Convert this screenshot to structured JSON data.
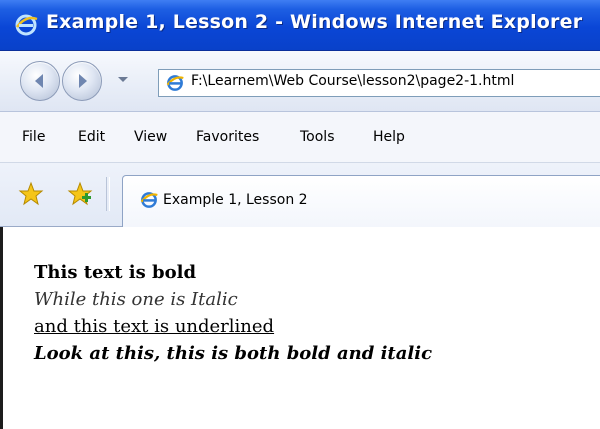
{
  "window": {
    "title": "Example 1, Lesson 2 - Windows Internet Explorer",
    "title_bar_color": "#0a46d6"
  },
  "address_bar": {
    "url": "F:\\Learnem\\Web Course\\lesson2\\page2-1.html",
    "icons": [
      "back-arrow-icon",
      "forward-arrow-icon",
      "ie-logo-icon"
    ]
  },
  "menu": {
    "items": [
      "File",
      "Edit",
      "View",
      "Favorites",
      "Tools",
      "Help"
    ]
  },
  "favorites_bar": {
    "tab_label": "Example 1, Lesson 2",
    "icons": [
      "favorites-star-icon",
      "add-favorites-icon",
      "ie-logo-icon"
    ]
  },
  "content": {
    "lines": [
      "This text is bold",
      "While this one is Italic",
      "and this text is underlined",
      "Look at this, this is both bold and italic"
    ]
  }
}
